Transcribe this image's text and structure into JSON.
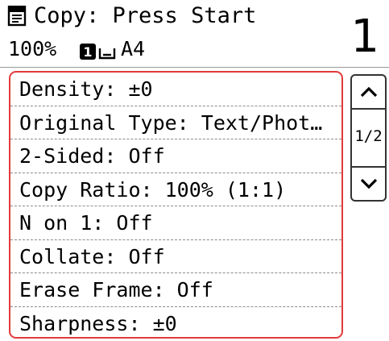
{
  "header": {
    "title": "Copy: Press Start",
    "copy_ratio": "100%",
    "paper_source": "1",
    "paper_size": "A4",
    "copies": "1"
  },
  "settings": [
    {
      "label": "Density: ±0"
    },
    {
      "label": "Original Type: Text/Phot…"
    },
    {
      "label": "2-Sided: Off"
    },
    {
      "label": "Copy Ratio: 100% (1:1)"
    },
    {
      "label": "N on 1: Off"
    },
    {
      "label": "Collate: Off"
    },
    {
      "label": "Erase Frame: Off"
    },
    {
      "label": "Sharpness: ±0"
    }
  ],
  "scroll": {
    "page_indicator": "1/2",
    "up_icon": "chevron-up-icon",
    "down_icon": "chevron-down-icon"
  },
  "icons": {
    "copy": "copy-document-icon",
    "paper": "paper-drawer-icon",
    "tray": "paper-tray-icon"
  },
  "colors": {
    "selection_border": "#e13b3b",
    "text": "#000000",
    "background": "#ffffff"
  }
}
